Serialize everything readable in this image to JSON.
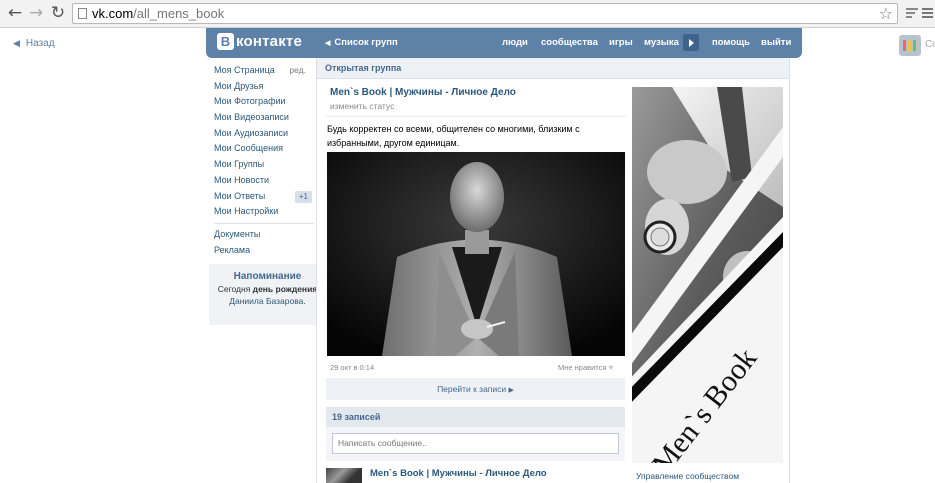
{
  "browser": {
    "url_host": "vk.com",
    "url_path": "/all_mens_book"
  },
  "page": {
    "back_label": "Назад"
  },
  "header": {
    "logo_text": "контакте",
    "logo_badge": "В",
    "groups_list_label": "Список групп",
    "nav": [
      "люди",
      "сообщества",
      "игры",
      "музыка",
      "помощь",
      "выйти"
    ]
  },
  "sidebar": {
    "items": [
      {
        "label": "Моя Страница",
        "edit": "ред."
      },
      {
        "label": "Мои Друзья"
      },
      {
        "label": "Мои Фотографии"
      },
      {
        "label": "Мои Видеозаписи"
      },
      {
        "label": "Мои Аудиозаписи"
      },
      {
        "label": "Мои Сообщения"
      },
      {
        "label": "Мои Группы"
      },
      {
        "label": "Мои Новости"
      },
      {
        "label": "Мои Ответы",
        "badge": "+1"
      },
      {
        "label": "Мои Настройки"
      }
    ],
    "extra": [
      "Документы",
      "Реклама"
    ],
    "reminder": {
      "title": "Напоминание",
      "text_before": "Сегодня ",
      "text_bold": "день рождения",
      "text_link": "Даниила Базарова",
      "text_after": "."
    }
  },
  "group": {
    "type_label": "Открытая группа",
    "name": "Men`s Book  |  Мужчины - Личное Дело",
    "status": "изменить статус",
    "description": "Будь корректен со всеми, общителен со многими, близким с избранными, другом единицам.",
    "post": {
      "date": "29 окт в 0:14",
      "like_label": "Мне нравится",
      "goto_label": "Перейти к записи"
    },
    "wall": {
      "count_label": "19 записей",
      "input_placeholder": "Написать сообщение..",
      "first_author": "Men`s Book  |  Мужчины - Личное Дело"
    },
    "cover_text": "Men`s Book",
    "manage_label": "Управление сообществом"
  },
  "extension": {
    "label": "Cc"
  },
  "colors": {
    "header_blue": "#5e81a8",
    "link_blue": "#2b587a"
  }
}
